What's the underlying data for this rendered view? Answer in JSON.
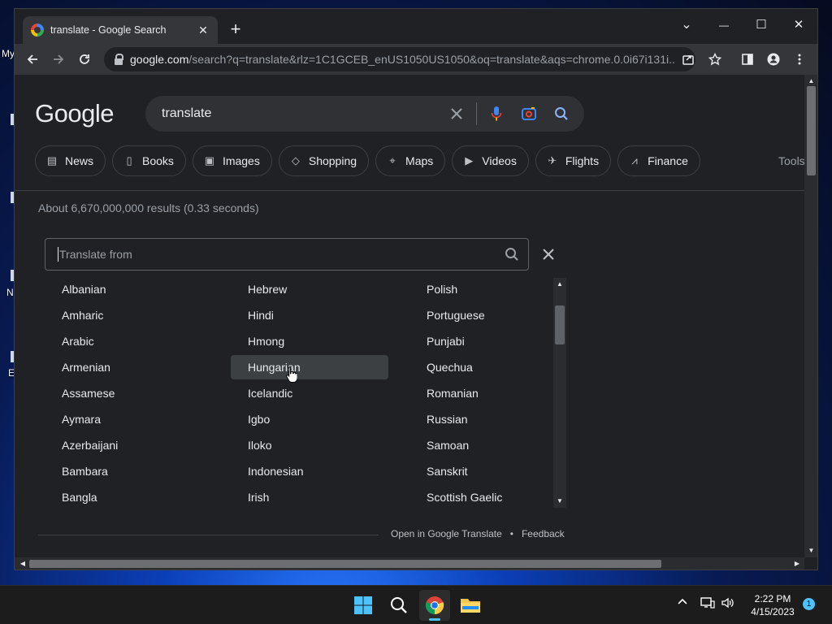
{
  "desktop": {
    "labels": [
      "My",
      "N",
      "E"
    ]
  },
  "tab": {
    "title": "translate - Google Search",
    "close": "✕"
  },
  "new_tab": "+",
  "window": {
    "minimize": "—",
    "maximize": "☐",
    "close": "✕",
    "tab_search": "⌄"
  },
  "toolbar": {
    "url_host": "google.com",
    "url_path": "/search?q=translate&rlz=1C1GCEB_enUS1050US1050&oq=translate&aqs=chrome.0.0i67i131i..."
  },
  "google": {
    "logo": "Google",
    "query": "translate",
    "chips": [
      {
        "label": "News",
        "icon": "news-icon"
      },
      {
        "label": "Books",
        "icon": "book-icon"
      },
      {
        "label": "Images",
        "icon": "image-icon"
      },
      {
        "label": "Shopping",
        "icon": "tag-icon"
      },
      {
        "label": "Maps",
        "icon": "map-pin-icon"
      },
      {
        "label": "Videos",
        "icon": "video-icon"
      },
      {
        "label": "Flights",
        "icon": "plane-icon"
      },
      {
        "label": "Finance",
        "icon": "finance-icon"
      }
    ],
    "tools": "Tools",
    "stats": "About 6,670,000,000 results (0.33 seconds)"
  },
  "translate": {
    "placeholder": "Translate from",
    "hovered": "Hungarian",
    "columns": [
      [
        "Albanian",
        "Amharic",
        "Arabic",
        "Armenian",
        "Assamese",
        "Aymara",
        "Azerbaijani",
        "Bambara",
        "Bangla"
      ],
      [
        "Hebrew",
        "Hindi",
        "Hmong",
        "Hungarian",
        "Icelandic",
        "Igbo",
        "Iloko",
        "Indonesian",
        "Irish"
      ],
      [
        "Polish",
        "Portuguese",
        "Punjabi",
        "Quechua",
        "Romanian",
        "Russian",
        "Samoan",
        "Sanskrit",
        "Scottish Gaelic"
      ]
    ],
    "footer": {
      "open": "Open in Google Translate",
      "sep": "•",
      "feedback": "Feedback"
    }
  },
  "taskbar": {
    "time": "2:22 PM",
    "date": "4/15/2023",
    "notifications": "1"
  }
}
